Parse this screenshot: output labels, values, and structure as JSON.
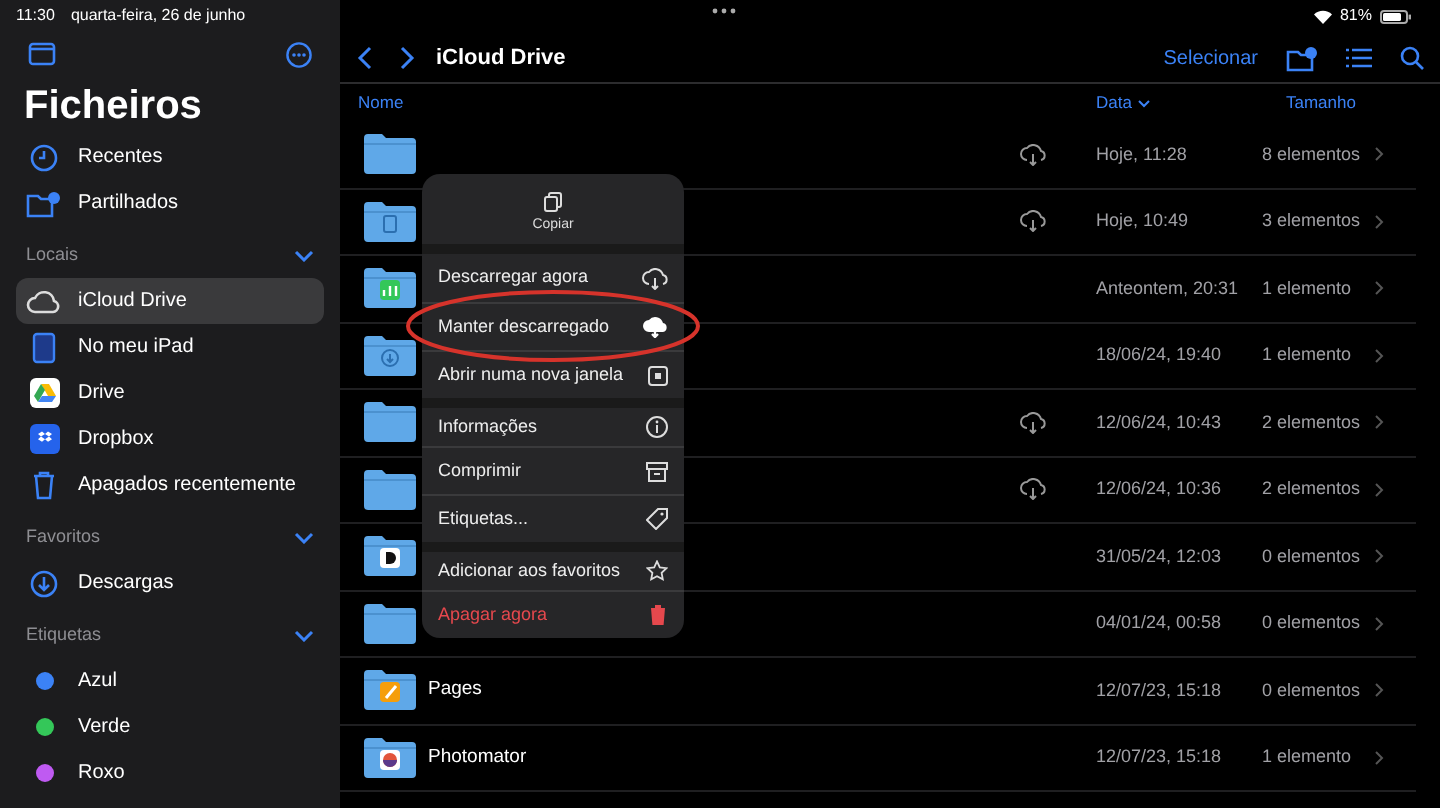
{
  "status_bar": {
    "time": "11:30",
    "date": "quarta-feira, 26 de junho",
    "battery": "81%"
  },
  "sidebar": {
    "title": "Ficheiros",
    "top_items": [
      {
        "label": "Recentes",
        "kind": "clock"
      },
      {
        "label": "Partilhados",
        "kind": "shared"
      }
    ],
    "sections": [
      {
        "title": "Locais",
        "expanded": true,
        "items": [
          {
            "label": "iCloud Drive",
            "kind": "cloud",
            "selected": true
          },
          {
            "label": "No meu iPad",
            "kind": "ipad",
            "selected": false
          },
          {
            "label": "Drive",
            "kind": "drive",
            "selected": false
          },
          {
            "label": "Dropbox",
            "kind": "dropbox",
            "selected": false
          },
          {
            "label": "Apagados recentemente",
            "kind": "trash",
            "selected": false
          }
        ]
      },
      {
        "title": "Favoritos",
        "expanded": true,
        "items": [
          {
            "label": "Descargas",
            "kind": "download",
            "selected": false
          }
        ]
      },
      {
        "title": "Etiquetas",
        "expanded": true,
        "items": [
          {
            "label": "Azul",
            "kind": "tag",
            "color": "#3b82f6",
            "selected": false
          },
          {
            "label": "Verde",
            "kind": "tag",
            "color": "#34c759",
            "selected": false
          },
          {
            "label": "Roxo",
            "kind": "tag",
            "color": "#bf5af2",
            "selected": false
          }
        ]
      }
    ]
  },
  "toolbar": {
    "title": "iCloud Drive",
    "select": "Selecionar"
  },
  "table": {
    "columns": [
      "Nome",
      "Data",
      "Tamanho"
    ],
    "rows": [
      {
        "kind": "plain",
        "cloud": true,
        "date": "Hoje, 11:28",
        "size": "8 elementos"
      },
      {
        "kind": "doc",
        "cloud": true,
        "date": "Hoje, 10:49",
        "size": "3 elementos"
      },
      {
        "kind": "chart",
        "cloud": false,
        "date": "Anteontem, 20:31",
        "size": "1 elemento"
      },
      {
        "kind": "download",
        "cloud": false,
        "date": "18/06/24, 19:40",
        "size": "1 elemento"
      },
      {
        "kind": "plain",
        "cloud": true,
        "date": "12/06/24, 10:43",
        "size": "2 elementos"
      },
      {
        "kind": "plain",
        "cloud": true,
        "date": "12/06/24, 10:36",
        "size": "2 elementos"
      },
      {
        "kind": "app",
        "cloud": false,
        "date": "31/05/24, 12:03",
        "size": "0 elementos"
      },
      {
        "kind": "plain",
        "cloud": false,
        "date": "04/01/24, 00:58",
        "size": "0 elementos"
      },
      {
        "kind": "pages",
        "name": "Pages",
        "cloud": false,
        "date": "12/07/23, 15:18",
        "size": "0 elementos"
      },
      {
        "kind": "photo",
        "name": "Photomator",
        "cloud": false,
        "date": "12/07/23, 15:18",
        "size": "1 elemento"
      }
    ]
  },
  "context_menu": {
    "top_action": "Copiar",
    "items": [
      {
        "label": "Descarregar agora",
        "kind": "cloud-down",
        "destructive": false,
        "circled": false
      },
      {
        "label": "Manter descarregado",
        "kind": "cloud-filled",
        "destructive": false,
        "circled": true
      },
      {
        "label": "Abrir numa nova janela",
        "kind": "window",
        "destructive": false,
        "circled": false
      },
      {
        "label": "Informações",
        "kind": "info",
        "destructive": false,
        "circled": false
      },
      {
        "label": "Comprimir",
        "kind": "archive",
        "destructive": false,
        "circled": false
      },
      {
        "label": "Etiquetas...",
        "kind": "tag",
        "destructive": false,
        "circled": false
      },
      {
        "label": "Adicionar aos favoritos",
        "kind": "star",
        "destructive": false,
        "circled": false
      },
      {
        "label": "Apagar agora",
        "kind": "trash",
        "destructive": true,
        "circled": false
      }
    ]
  }
}
